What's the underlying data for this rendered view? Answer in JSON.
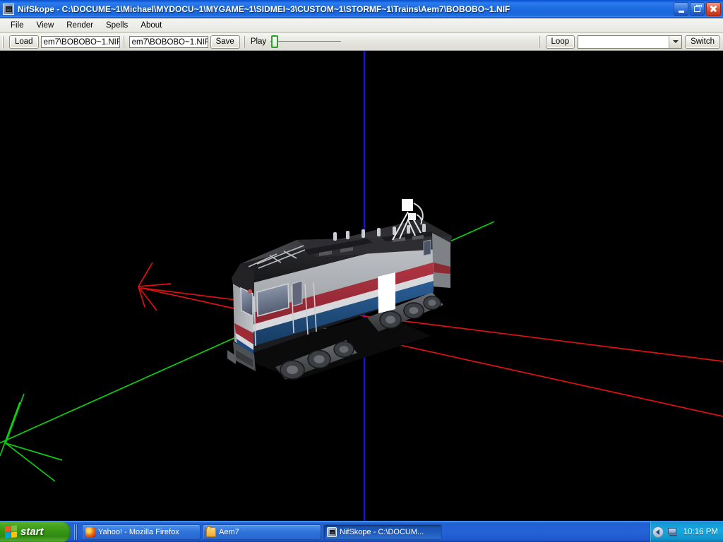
{
  "window": {
    "title": "NifSkope - C:\\DOCUME~1\\Michael\\MYDOCU~1\\MYGAME~1\\SIDMEI~3\\CUSTOM~1\\STORMF~1\\Trains\\Aem7\\BOBOBO~1.NIF",
    "icon": "nifskope-app-icon",
    "minimize_label": "Minimize",
    "restore_label": "Restore",
    "close_label": "Close"
  },
  "menu": {
    "items": [
      {
        "label": "File"
      },
      {
        "label": "View"
      },
      {
        "label": "Render"
      },
      {
        "label": "Spells"
      },
      {
        "label": "About"
      }
    ]
  },
  "toolbar": {
    "load_label": "Load",
    "load_path_value": "em7\\BOBOBO~1.NIF",
    "save_path_value": "em7\\BOBOBO~1.NIF",
    "save_label": "Save",
    "play_label": "Play",
    "animation_slider_value": 0,
    "loop_label": "Loop",
    "sequence_value": "",
    "sequence_placeholder": "",
    "switch_label": "Switch"
  },
  "viewport": {
    "background_color": "#000000",
    "axes": {
      "x_color": "#e01010",
      "y_color": "#10d010",
      "z_color": "#1414d8"
    },
    "model": {
      "name": "AEM-7 electric locomotive",
      "body_color": "#a9acb0",
      "roof_color": "#2a2a2c",
      "stripe_red": "#9e2b36",
      "stripe_white": "#d8dadd",
      "skirt_blue": "#1f4c80",
      "untextured_color": "#ffffff",
      "truck_color": "#55585c"
    }
  },
  "taskbar": {
    "start_label": "start",
    "items": [
      {
        "label": "Yahoo! - Mozilla Firefox",
        "icon": "firefox-icon",
        "active": false
      },
      {
        "label": "Aem7",
        "icon": "folder-icon",
        "active": false
      },
      {
        "label": "NifSkope - C:\\DOCUM...",
        "icon": "nifskope-icon",
        "active": true
      }
    ],
    "tray": {
      "expand_icon": "chevron-left-icon",
      "network_icon": "network-icon",
      "clock": "10:16 PM"
    }
  }
}
